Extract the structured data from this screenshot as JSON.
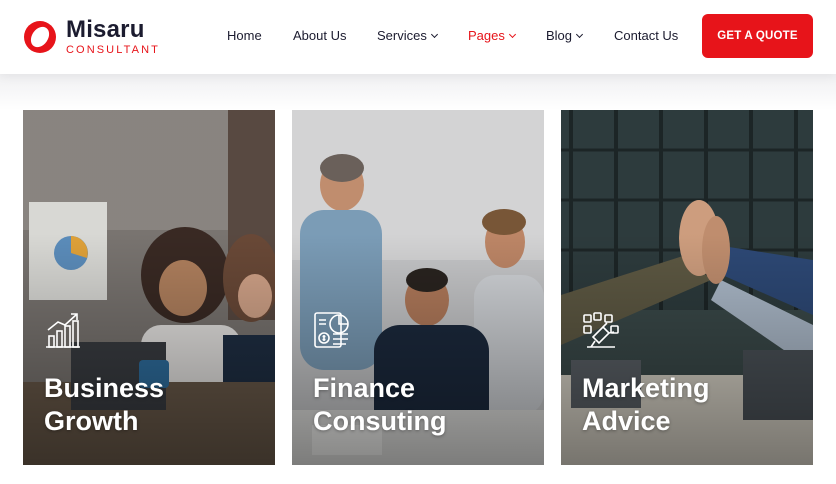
{
  "brand": {
    "name": "Misaru",
    "tagline": "CONSULTANT",
    "accent": "#e7141a"
  },
  "nav": {
    "items": [
      {
        "label": "Home",
        "dropdown": false,
        "active": false
      },
      {
        "label": "About Us",
        "dropdown": false,
        "active": false
      },
      {
        "label": "Services",
        "dropdown": true,
        "active": false
      },
      {
        "label": "Pages",
        "dropdown": true,
        "active": true
      },
      {
        "label": "Blog",
        "dropdown": true,
        "active": false
      },
      {
        "label": "Contact Us",
        "dropdown": false,
        "active": false
      }
    ],
    "cta_label": "GET A QUOTE"
  },
  "cards": [
    {
      "line1": "Business",
      "line2": "Growth",
      "icon": "growth-chart-icon"
    },
    {
      "line1": "Finance",
      "line2": "Consuting",
      "icon": "finance-report-icon"
    },
    {
      "line1": "Marketing",
      "line2": "Advice",
      "icon": "digital-marketing-icon"
    }
  ]
}
